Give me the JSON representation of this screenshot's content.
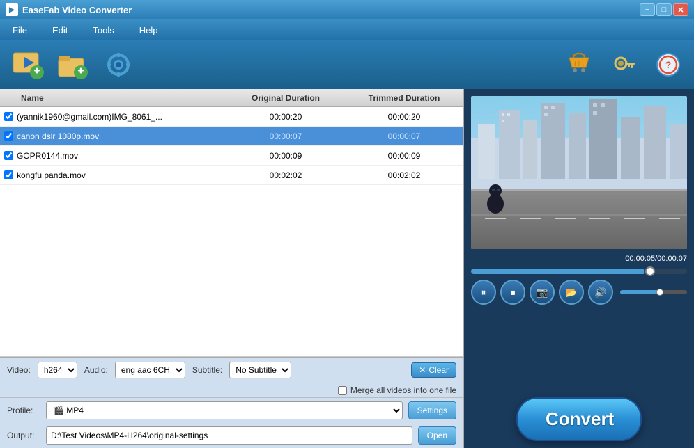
{
  "window": {
    "title": "EaseFab Video Converter"
  },
  "title_bar": {
    "minimize": "–",
    "maximize": "□",
    "close": "✕"
  },
  "menu": {
    "items": [
      "File",
      "Edit",
      "Tools",
      "Help"
    ]
  },
  "toolbar": {
    "btn1_icon": "🎬",
    "btn2_icon": "🎞",
    "btn3_icon": "⚙",
    "right_icons": [
      "🛒",
      "🔑",
      "⭕"
    ]
  },
  "table": {
    "headers": [
      "Name",
      "Original Duration",
      "Trimmed Duration"
    ],
    "rows": [
      {
        "checked": true,
        "name": "(yannik1960@gmail.com)IMG_8061_...",
        "original": "00:00:20",
        "trimmed": "00:00:20",
        "selected": false
      },
      {
        "checked": true,
        "name": "canon dslr 1080p.mov",
        "original": "00:00:07",
        "trimmed": "00:00:07",
        "selected": true
      },
      {
        "checked": true,
        "name": "GOPR0144.mov",
        "original": "00:00:09",
        "trimmed": "00:00:09",
        "selected": false
      },
      {
        "checked": true,
        "name": "kongfu panda.mov",
        "original": "00:02:02",
        "trimmed": "00:02:02",
        "selected": false
      }
    ]
  },
  "controls": {
    "video_label": "Video:",
    "video_value": "h264",
    "audio_label": "Audio:",
    "audio_value": "eng aac 6CH",
    "subtitle_label": "Subtitle:",
    "subtitle_value": "No Subtitle",
    "clear_label": "Clear",
    "merge_label": "Merge all videos into one file"
  },
  "profile": {
    "label": "Profile:",
    "value": "MP4",
    "settings_btn": "Settings"
  },
  "output": {
    "label": "Output:",
    "path": "D:\\Test Videos\\MP4-H264\\original-settings",
    "open_btn": "Open"
  },
  "preview": {
    "time_display": "00:00:05/00:00:07"
  },
  "convert": {
    "label": "Convert"
  }
}
